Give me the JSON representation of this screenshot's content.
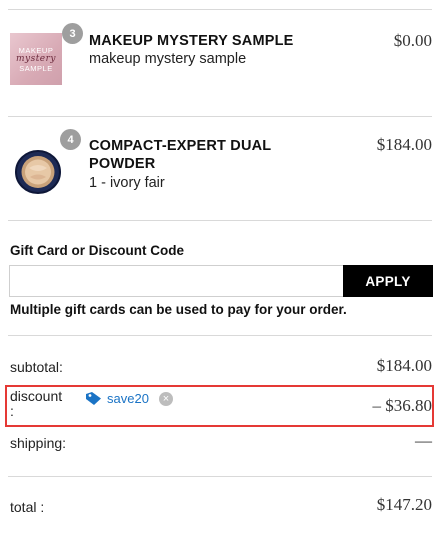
{
  "cart_items": [
    {
      "quantity": "3",
      "title": "MAKEUP MYSTERY SAMPLE",
      "variant": "makeup mystery sample",
      "price": "$0.00",
      "thumb_text": [
        "MAKEUP",
        "mystery",
        "SAMPLE"
      ],
      "icon": "mystery-sample-thumbnail"
    },
    {
      "quantity": "4",
      "title_line1": "COMPACT-EXPERT DUAL",
      "title_line2": "POWDER",
      "variant": "1 - ivory fair",
      "price": "$184.00",
      "icon": "compact-powder-thumbnail"
    }
  ],
  "gift_card": {
    "label": "Gift Card or Discount Code",
    "placeholder": "",
    "apply_label": "APPLY",
    "note": "Multiple gift cards can be used to pay for your order."
  },
  "summary": {
    "subtotal_label": "subtotal:",
    "subtotal_value": "$184.00",
    "discount_label": "discount",
    "discount_colon": ":",
    "discount_code": "save20",
    "discount_value": "– $36.80",
    "shipping_label": "shipping:",
    "shipping_value": "—",
    "total_label": "total :",
    "total_value": "$147.20"
  },
  "colors": {
    "highlight": "#e53935",
    "tag_blue": "#1a73c5",
    "apply_bg": "#000000"
  }
}
